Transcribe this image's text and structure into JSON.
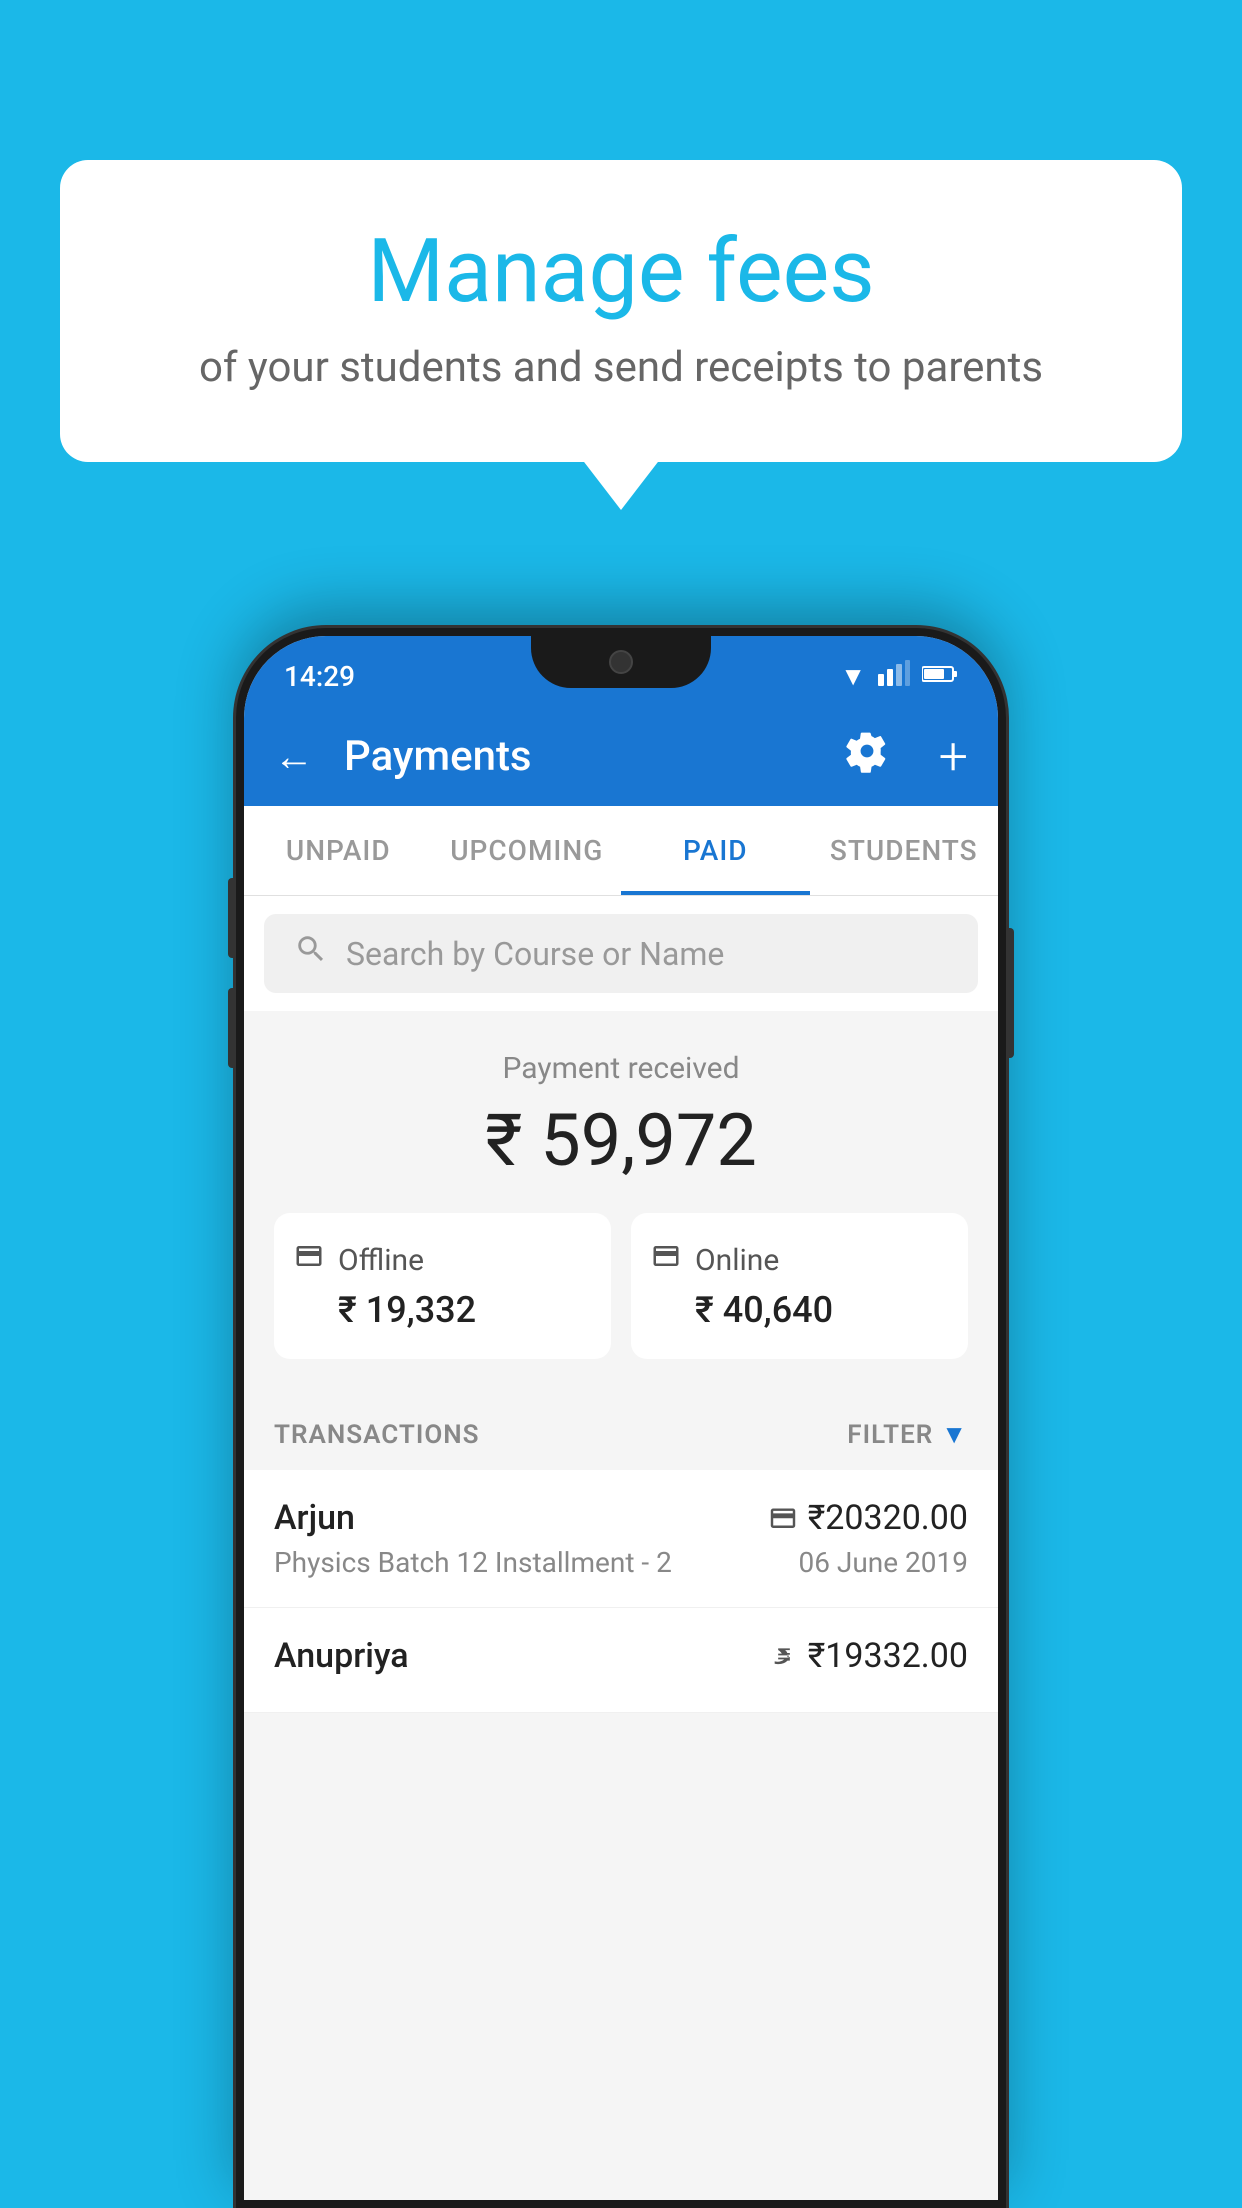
{
  "background_color": "#1bb8e8",
  "bubble": {
    "title": "Manage fees",
    "subtitle": "of your students and send receipts to parents"
  },
  "status_bar": {
    "time": "14:29",
    "wifi": "▼",
    "signal": "▲",
    "battery": "▐"
  },
  "header": {
    "title": "Payments",
    "back_label": "←",
    "settings_label": "⚙",
    "plus_label": "+"
  },
  "tabs": [
    {
      "label": "UNPAID",
      "active": false
    },
    {
      "label": "UPCOMING",
      "active": false
    },
    {
      "label": "PAID",
      "active": true
    },
    {
      "label": "STUDENTS",
      "active": false
    }
  ],
  "search": {
    "placeholder": "Search by Course or Name"
  },
  "payment_summary": {
    "received_label": "Payment received",
    "total_amount": "₹ 59,972",
    "offline": {
      "label": "Offline",
      "amount": "₹ 19,332"
    },
    "online": {
      "label": "Online",
      "amount": "₹ 40,640"
    }
  },
  "transactions_section": {
    "label": "TRANSACTIONS",
    "filter_label": "FILTER"
  },
  "transactions": [
    {
      "name": "Arjun",
      "amount": "₹20320.00",
      "payment_type": "card",
      "course": "Physics Batch 12 Installment - 2",
      "date": "06 June 2019"
    },
    {
      "name": "Anupriya",
      "amount": "₹19332.00",
      "payment_type": "cash",
      "course": "",
      "date": ""
    }
  ]
}
